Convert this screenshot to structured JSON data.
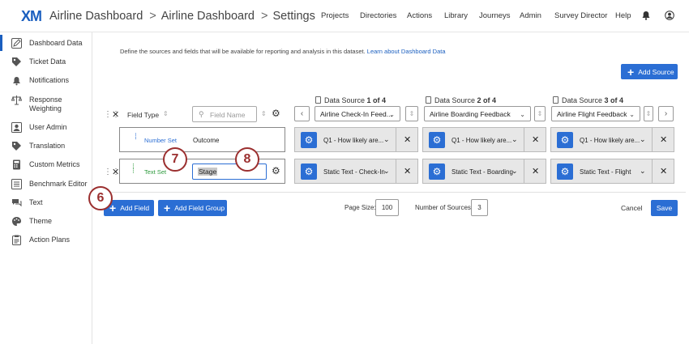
{
  "header": {
    "logo": "XM",
    "breadcrumb": [
      "Airline Dashboard",
      "Airline Dashboard",
      "Settings"
    ],
    "nav": [
      "Projects",
      "Directories",
      "Actions",
      "Library",
      "Journeys",
      "Admin",
      "Survey Director",
      "Help"
    ]
  },
  "sidebar": {
    "items": [
      {
        "label": "Dashboard Data",
        "icon": "pencil-icon",
        "active": true
      },
      {
        "label": "Ticket Data",
        "icon": "tag-icon"
      },
      {
        "label": "Notifications",
        "icon": "bell-icon"
      },
      {
        "label": "Response Weighting",
        "icon": "scale-icon"
      },
      {
        "label": "User Admin",
        "icon": "user-icon"
      },
      {
        "label": "Translation",
        "icon": "tag-icon"
      },
      {
        "label": "Custom Metrics",
        "icon": "calculator-icon"
      },
      {
        "label": "Benchmark Editor",
        "icon": "list-icon"
      },
      {
        "label": "Text",
        "icon": "chat-icon"
      },
      {
        "label": "Theme",
        "icon": "palette-icon"
      },
      {
        "label": "Action Plans",
        "icon": "clipboard-icon"
      }
    ]
  },
  "main": {
    "description": "Define the sources and fields that will be available for reporting and analysis in this dataset.",
    "learn_link": "Learn about Dashboard Data",
    "add_source": "Add Source",
    "field_type_label": "Field Type",
    "field_name_placeholder": "Field Name",
    "data_sources": [
      {
        "prefix": "Data Source ",
        "num": "1 of 4",
        "selected": "Airline Check-In Feed..."
      },
      {
        "prefix": "Data Source ",
        "num": "2 of 4",
        "selected": "Airline Boarding Feedback"
      },
      {
        "prefix": "Data Source ",
        "num": "3 of 4",
        "selected": "Airline Flight Feedback"
      }
    ],
    "rows": [
      {
        "field_type": "Number Set",
        "field_name": "Outcome",
        "mappings": [
          "Q1 - How likely are...",
          "Q1 - How likely are...",
          "Q1 - How likely are..."
        ]
      },
      {
        "field_type": "Text Set",
        "field_name": "Stage",
        "mappings": [
          "Static Text - Check-In",
          "Static Text - Boarding",
          "Static Text - Flight"
        ]
      }
    ],
    "add_field": "Add Field",
    "add_field_group": "Add Field Group",
    "page_size_label": "Page Size:",
    "page_size_value": "100",
    "num_sources_label": "Number of Sources:",
    "num_sources_value": "3",
    "cancel": "Cancel",
    "save": "Save"
  },
  "callouts": [
    "6",
    "7",
    "8"
  ],
  "colors": {
    "accent": "#2b6ed4",
    "callout": "#9b2f2f",
    "number_set": "#2b6ed4",
    "text_set": "#2e9a3e"
  }
}
